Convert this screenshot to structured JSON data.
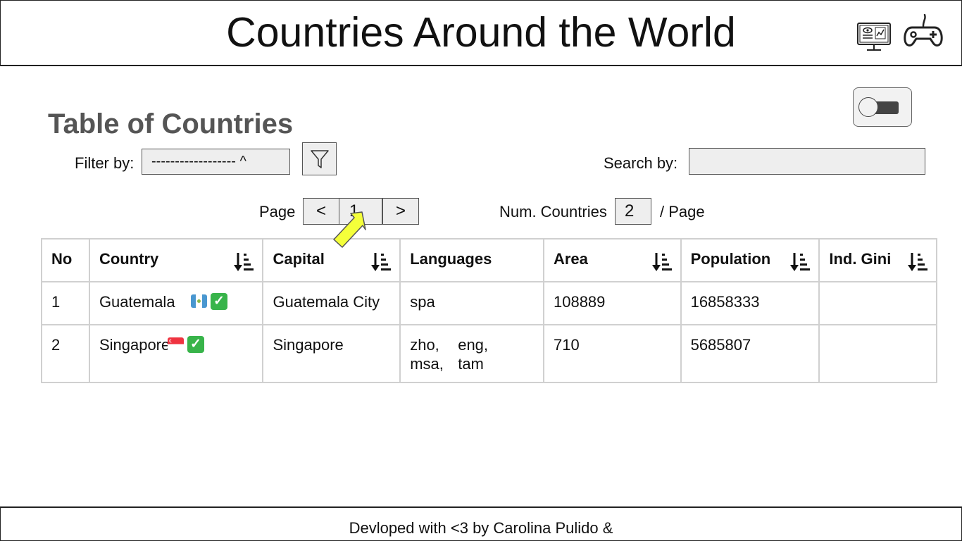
{
  "header": {
    "title": "Countries Around the World",
    "monitor_icon": "monitor-eye-chart-icon",
    "gamepad_icon": "gamepad-icon"
  },
  "section": {
    "title": "Table of Countries"
  },
  "toggle": {
    "state": "off",
    "icon": "toggle-switch-icon"
  },
  "filter": {
    "label": "Filter by:",
    "select_value": "------------------ ^",
    "button_icon": "funnel-icon"
  },
  "search": {
    "label": "Search by:",
    "value": ""
  },
  "pagination": {
    "page_label": "Page",
    "prev": "<",
    "current": "1",
    "next": ">",
    "num_label": "Num. Countries",
    "per_page_value": "2",
    "per_page_suffix": "/ Page"
  },
  "table": {
    "headers": [
      "No",
      "Country",
      "Capital",
      "Languages",
      "Area",
      "Population",
      "Ind. Gini"
    ],
    "rows": [
      {
        "no": "1",
        "country": "Guatemala",
        "flag": "flag-guatemala-icon",
        "status_icon": "check-mark-icon",
        "capital": "Guatemala City",
        "languages": [
          "spa"
        ],
        "area": "108889",
        "population": "16858333",
        "gini": ""
      },
      {
        "no": "2",
        "country": "Singapore",
        "flag": "flag-singapore-icon",
        "status_icon": "check-mark-icon",
        "capital": "Singapore",
        "languages": [
          "zho,",
          "eng,",
          "msa,",
          "tam"
        ],
        "area": "710",
        "population": "5685807",
        "gini": ""
      }
    ]
  },
  "footer": {
    "text": "Devloped with <3 by Carolina Pulido &"
  },
  "colors": {
    "cursor": "#f4ff3a",
    "check": "#38b44a",
    "input_bg": "#eeeeee",
    "section_title": "#555555"
  }
}
